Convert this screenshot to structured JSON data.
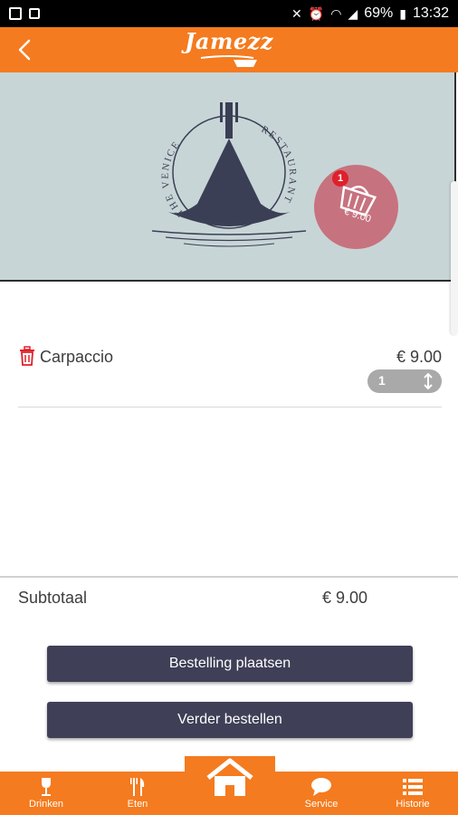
{
  "status_bar": {
    "battery_percent": "69%",
    "time": "13:32",
    "icons": [
      "gallery-icon",
      "sim-icon",
      "mute-icon",
      "alarm-icon",
      "wifi-icon",
      "signal-icon",
      "battery-icon"
    ]
  },
  "header": {
    "brand": "Jamezz",
    "back_icon": "chevron-left-icon"
  },
  "hero": {
    "logo_text_left": "THE VENICE",
    "logo_text_right": "RESTAURANT",
    "cart": {
      "count": "1",
      "price": "€ 9.00"
    }
  },
  "order": {
    "items": [
      {
        "name": "Carpaccio",
        "price": "€ 9.00",
        "quantity": "1"
      }
    ]
  },
  "subtotal": {
    "label": "Subtotaal",
    "value": "€ 9.00"
  },
  "actions": {
    "place_order": "Bestelling plaatsen",
    "continue_ordering": "Verder bestellen"
  },
  "bottom_nav": {
    "items": [
      {
        "label": "Drinken",
        "icon": "wine-glass-icon"
      },
      {
        "label": "Eten",
        "icon": "fork-knife-icon"
      },
      {
        "label": "Service",
        "icon": "chat-bubble-icon"
      },
      {
        "label": "Historie",
        "icon": "list-icon"
      }
    ],
    "home_icon": "home-icon"
  },
  "colors": {
    "brand_orange": "#f47b1f",
    "button_navy": "#3f3f57",
    "hero_bg": "#c8d5d7",
    "cart_badge": "#c7727f",
    "badge_red": "#e0202a",
    "trash_red": "#e0202a"
  }
}
